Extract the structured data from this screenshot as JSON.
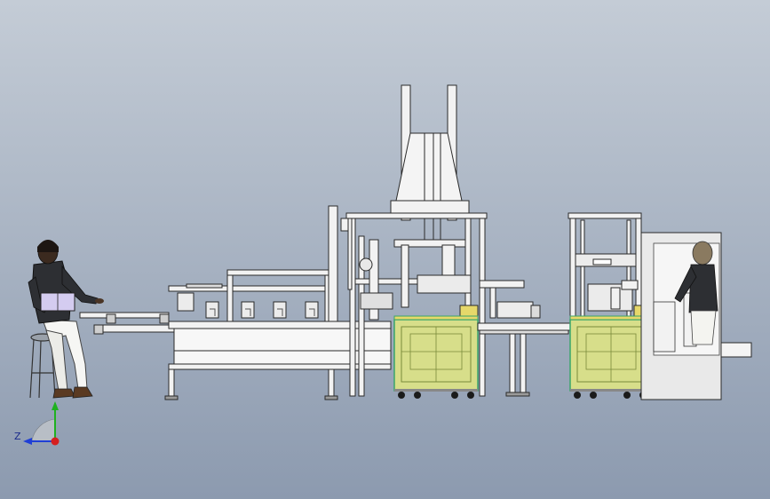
{
  "viewport": {
    "background_top": "#c4ccd6",
    "background_bottom": "#8c9aaf"
  },
  "colors": {
    "frame_line": "#2a2a2a",
    "frame_fill": "#f2f2f2",
    "guard_fill": "#d7de8a",
    "guard_edge": "#3aa56a",
    "accent_yellow": "#e6d86a",
    "wheel": "#1b1b1b",
    "wall": "#e9e9e9"
  },
  "triad": {
    "axis_z_label": "Z",
    "x_color": "#d61f1f",
    "y_color": "#1fb11f",
    "z_color": "#1f3fd6"
  },
  "people": {
    "left_operator": "seated-operator",
    "right_operator": "standing-operator"
  }
}
